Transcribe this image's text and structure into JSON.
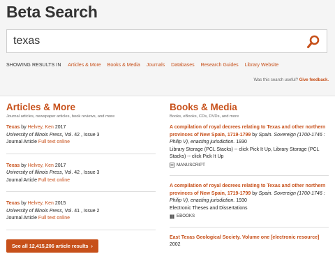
{
  "header": {
    "title": "Beta Search"
  },
  "search": {
    "value": "texas"
  },
  "showing": {
    "label": "SHOWING RESULTS IN",
    "links": [
      "Articles & More",
      "Books & Media",
      "Journals",
      "Databases",
      "Research Guides",
      "Library Website"
    ]
  },
  "feedback": {
    "question": "Was this search useful?",
    "link": "Give feedback."
  },
  "articles": {
    "title": "Articles & More",
    "desc": "Journal articles, newspaper articles, book reviews, and more",
    "items": [
      {
        "title": "Texas",
        "by": "by",
        "author": "Helvey, Ken",
        "year": "2017",
        "journal": "University of Illinois Press",
        "details": ", Vol. 42 , Issue 3",
        "type": "Journal Article",
        "link": "Full text online"
      },
      {
        "title": "Texas",
        "by": "by",
        "author": "Helvey, Ken",
        "year": "2017",
        "journal": "University of Illinois Press",
        "details": ", Vol. 42 , Issue 3",
        "type": "Journal Article",
        "link": "Full text online"
      },
      {
        "title": "Texas",
        "by": "by",
        "author": "Helvey, Ken",
        "year": "2015",
        "journal": "University of Illinois Press",
        "details": ", Vol. 41 , Issue 2",
        "type": "Journal Article",
        "link": "Full text online"
      }
    ],
    "see_all": "See all 12,415,206 article results"
  },
  "books": {
    "title": "Books & Media",
    "desc": "Books, eBooks, CDs, DVDs, and more",
    "items": [
      {
        "title": "A compilation of royal decrees relating to Texas and other northern provinces of New Spain, 1719-1799",
        "by": "by",
        "author": "Spain. Sovereign (1700-1746 : Philip V), enacting jurisdiction.",
        "year": "1930",
        "location": "Library Storage (PCL Stacks) -- click Pick It Up, Library Storage (PCL Stacks) -- click Pick It Up",
        "format": "MANUSCRIPT",
        "format_icon": "manuscript-icon"
      },
      {
        "title": "A compilation of royal decrees relating to Texas and other northern provinces of New Spain, 1719-1799",
        "by": "by",
        "author": "Spain. Sovereign (1700-1746 : Philip V), enacting jurisdiction.",
        "year": "1930",
        "location": "Electronic Theses and Dissertations",
        "format": "EBOOKS",
        "format_icon": "ebook-icon"
      },
      {
        "title": "East Texas Geological Society. Volume one [electronic resource]",
        "year": "2002"
      }
    ]
  },
  "colors": {
    "accent": "#c7501a",
    "header_bg": "#f5f5f5"
  }
}
